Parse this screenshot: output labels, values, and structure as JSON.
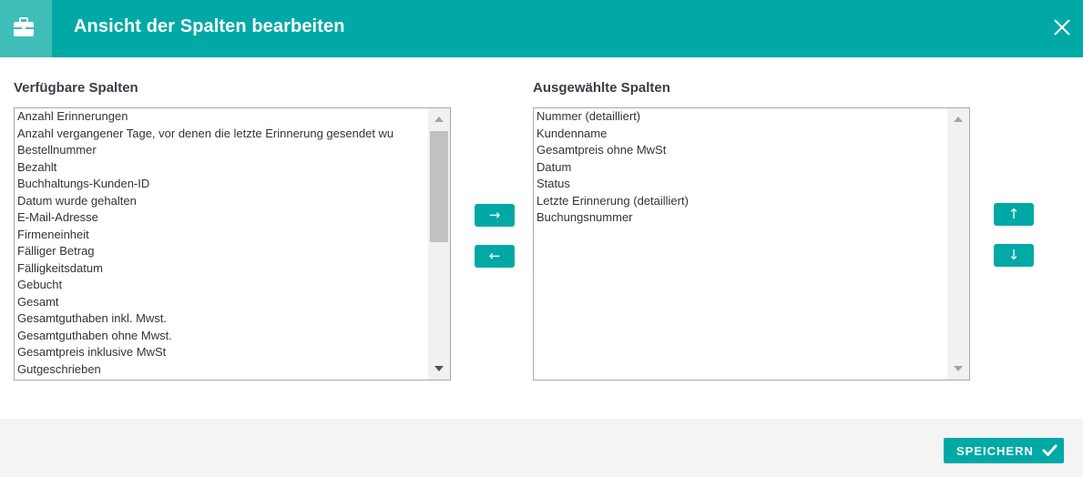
{
  "dialog": {
    "title": "Ansicht der Spalten bearbeiten",
    "header_icon": "briefcase-icon",
    "close_icon": "close-icon"
  },
  "available": {
    "label": "Verfügbare Spalten",
    "items": [
      "Anzahl Erinnerungen",
      "Anzahl vergangener Tage, vor denen die letzte Erinnerung gesendet wu",
      "Bestellnummer",
      "Bezahlt",
      "Buchhaltungs-Kunden-ID",
      "Datum wurde gehalten",
      "E-Mail-Adresse",
      "Firmeneinheit",
      "Fälliger Betrag",
      "Fälligkeitsdatum",
      "Gebucht",
      "Gesamt",
      "Gesamtguthaben inkl. Mwst.",
      "Gesamtguthaben ohne Mwst.",
      "Gesamtpreis inklusive MwSt",
      "Gutgeschrieben"
    ]
  },
  "selected": {
    "label": "Ausgewählte Spalten",
    "items": [
      "Nummer (detailliert)",
      "Kundenname",
      "Gesamtpreis ohne MwSt",
      "Datum",
      "Status",
      "Letzte Erinnerung (detailliert)",
      "Buchungsnummer"
    ]
  },
  "buttons": {
    "add": "→",
    "remove": "←",
    "move_up": "↑",
    "move_down": "↓",
    "save": "SPEICHERN"
  },
  "colors": {
    "accent": "#00a9a6",
    "accent_light": "#3fbdb8",
    "footer_bg": "#f4f4f4"
  }
}
